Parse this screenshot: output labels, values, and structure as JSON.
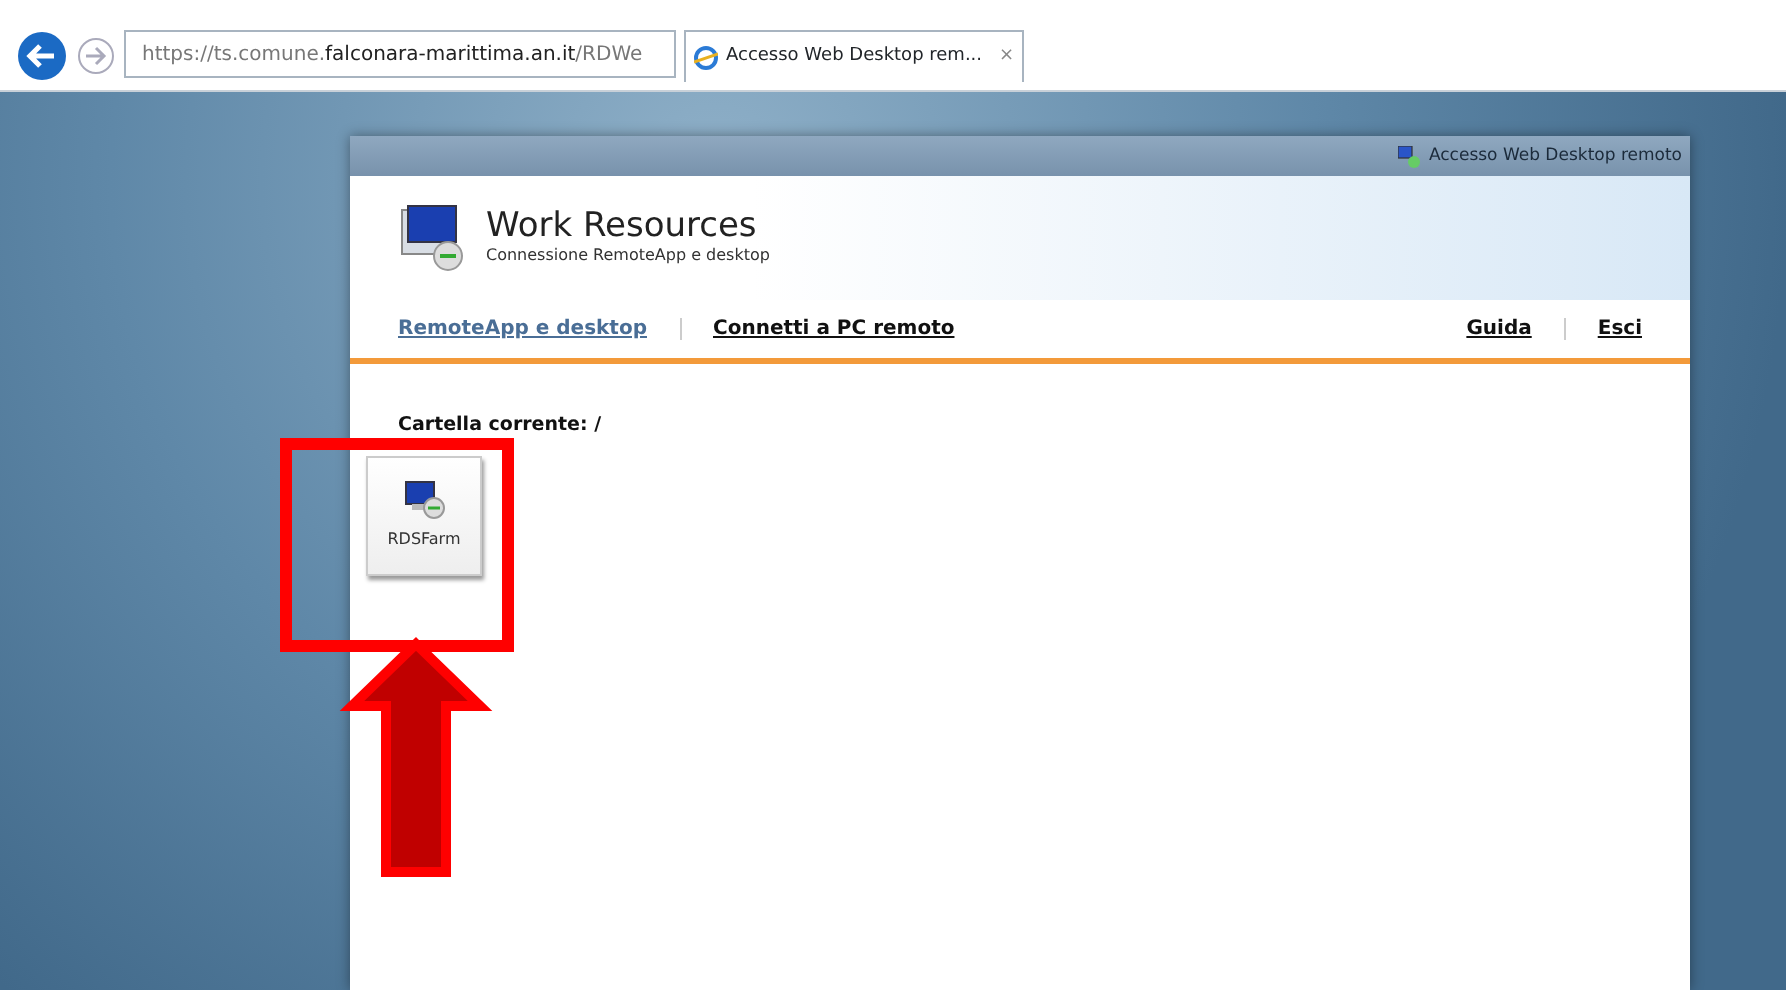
{
  "browser": {
    "url": "https://ts.comune.**falconara-marittima.an.it**/RDWe",
    "tab": {
      "title": "Accesso Web Desktop rem...",
      "close": "×",
      "selected": true
    }
  },
  "page": {
    "top_bar": "Accesso Web Desktop remoto",
    "title": "Work Resources",
    "subtitle": "Connessione RemoteApp e desktop",
    "nav": [
      {
        "label": "RemoteApp e desktop",
        "selected": true
      },
      {
        "label": "Connetti a PC remoto",
        "selected": false
      }
    ],
    "nav_right": [
      "Guida",
      "Esci"
    ],
    "current_folder": "Cartella corrente: /",
    "items": [
      {
        "label": "RDSFarm"
      }
    ]
  },
  "annotations": [
    {
      "kind": "rectangle"
    },
    {
      "kind": "arrow"
    }
  ]
}
